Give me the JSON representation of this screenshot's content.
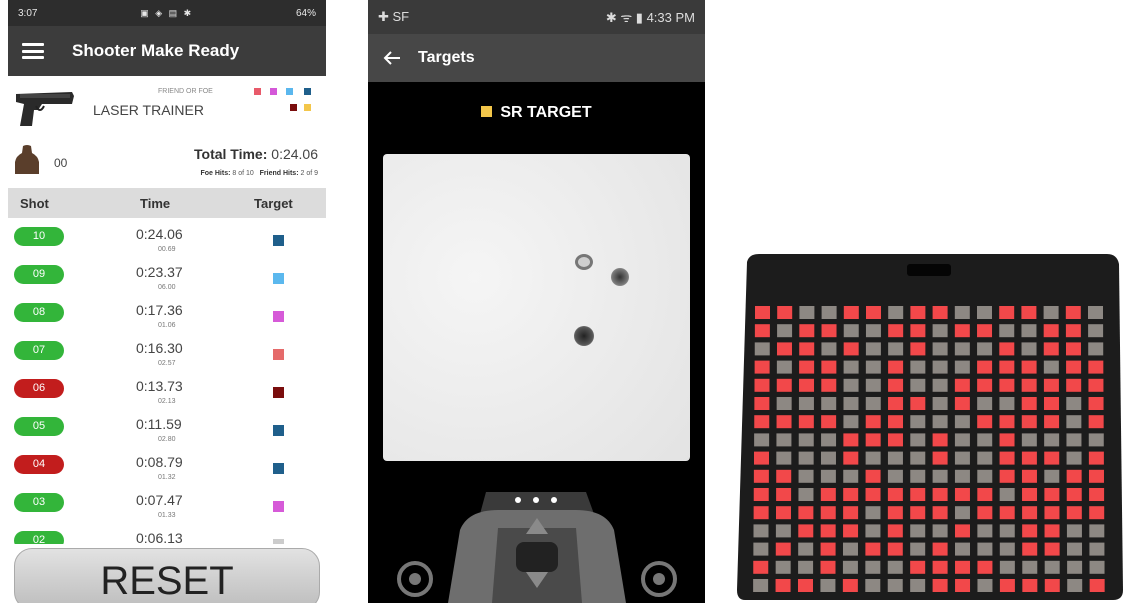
{
  "phone1": {
    "status_time": "3:07",
    "status_right": "64%",
    "app_title": "Shooter Make Ready",
    "friend_or_foe_label": "FRIEND OR FOE",
    "trainer_name": "LASER TRAINER",
    "counter": "00",
    "total_time_label": "Total Time:",
    "total_time_value": "0:24.06",
    "foe_hits_label": "Foe Hits:",
    "foe_hits_value": "8 of 10",
    "friend_hits_label": "Friend Hits:",
    "friend_hits_value": "2 of 9",
    "columns": {
      "shot": "Shot",
      "time": "Time",
      "target": "Target"
    },
    "rows": [
      {
        "shot": "10",
        "time": "0:24.06",
        "split": "00.69",
        "status": "green",
        "color": "#1f5f8b"
      },
      {
        "shot": "09",
        "time": "0:23.37",
        "split": "06.00",
        "status": "green",
        "color": "#5bb8ee"
      },
      {
        "shot": "08",
        "time": "0:17.36",
        "split": "01.06",
        "status": "green",
        "color": "#d65ad8"
      },
      {
        "shot": "07",
        "time": "0:16.30",
        "split": "02.57",
        "status": "green",
        "color": "#e56a6a"
      },
      {
        "shot": "06",
        "time": "0:13.73",
        "split": "02.13",
        "status": "red",
        "color": "#7a0d0d"
      },
      {
        "shot": "05",
        "time": "0:11.59",
        "split": "02.80",
        "status": "green",
        "color": "#1f5f8b"
      },
      {
        "shot": "04",
        "time": "0:08.79",
        "split": "01.32",
        "status": "red",
        "color": "#1f5f8b"
      },
      {
        "shot": "03",
        "time": "0:07.47",
        "split": "01.33",
        "status": "green",
        "color": "#d65ad8"
      },
      {
        "shot": "02",
        "time": "0:06.13",
        "split": "",
        "status": "green",
        "color": "#cccccc"
      }
    ],
    "reset_label": "RESET"
  },
  "phone2": {
    "status_time": "4:33 PM",
    "status_left": "SF",
    "app_title": "Targets",
    "target_label": "SR TARGET"
  },
  "colors": {
    "swatches": [
      "#e85a6a",
      "#d458d8",
      "#5ab7ee",
      "#1f5f8b",
      "#7a0d0d",
      "#f3c64a"
    ],
    "led_on": "#f2484a",
    "led_off": "#8d8883"
  }
}
